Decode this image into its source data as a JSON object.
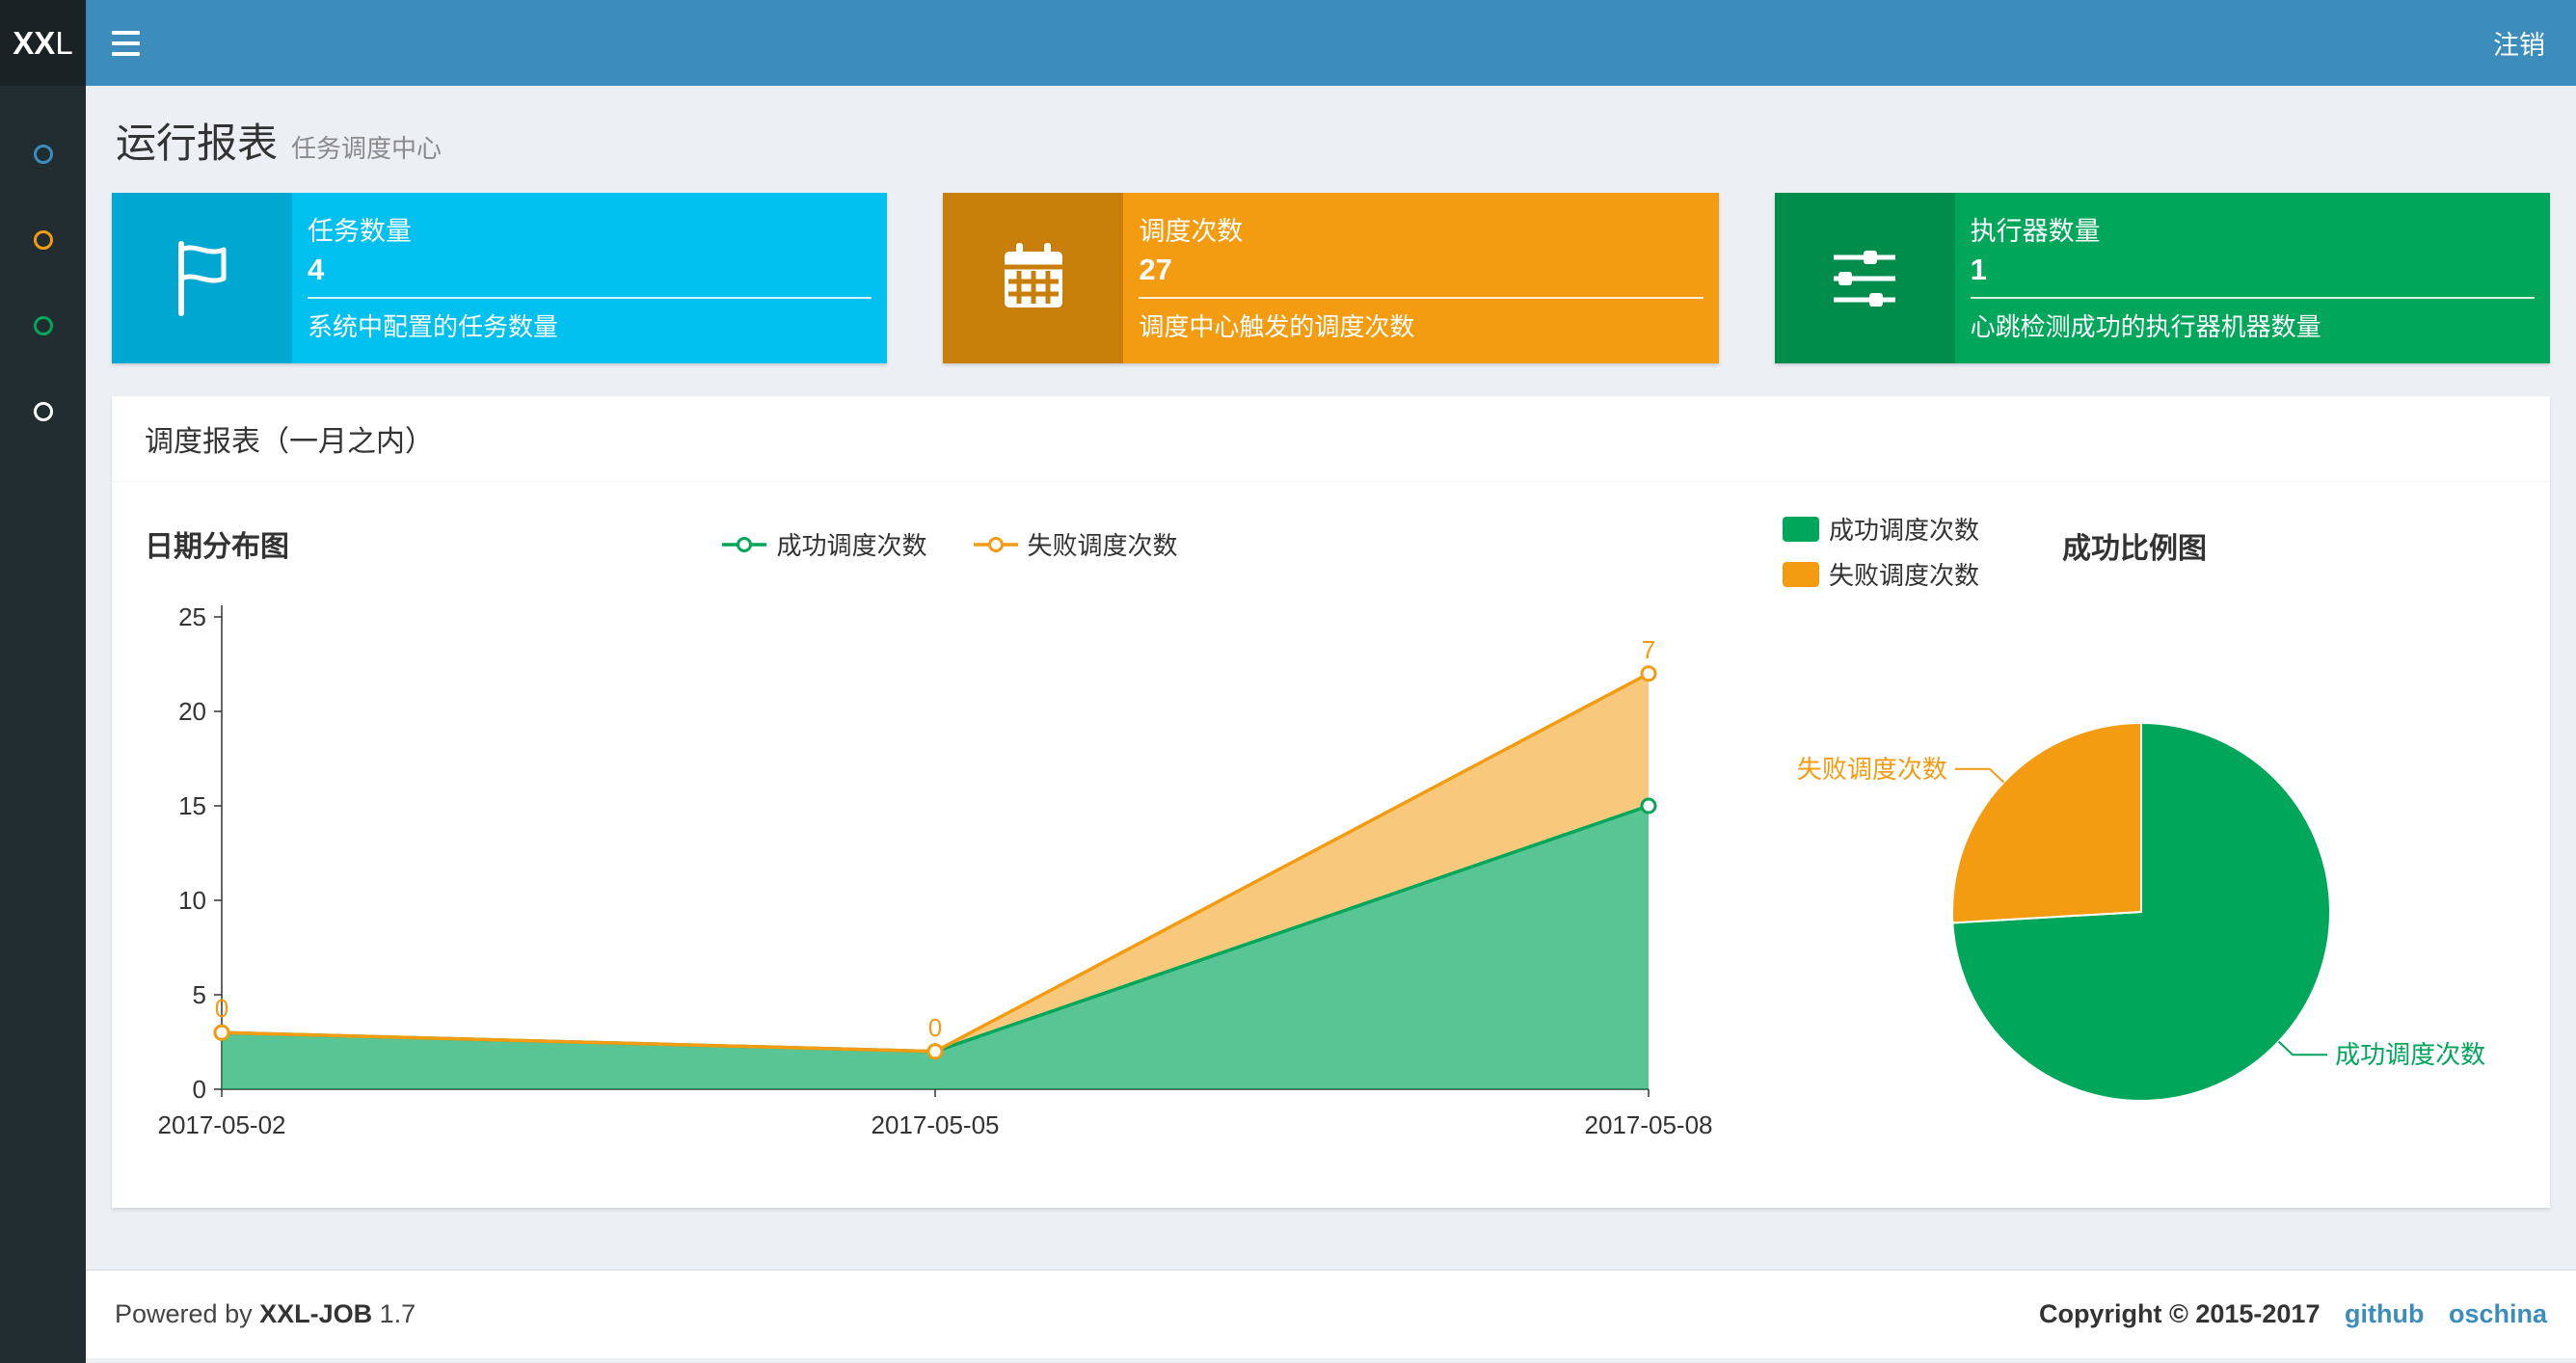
{
  "navbar": {
    "logo_bold": "XX",
    "logo_rest": "L",
    "logout_label": "注销"
  },
  "sidebar": {
    "items": [
      {
        "id": "1",
        "color": "#3c8dbc"
      },
      {
        "id": "2",
        "color": "#f39c12"
      },
      {
        "id": "3",
        "color": "#00a65a"
      },
      {
        "id": "4",
        "color": "#ffffff"
      }
    ]
  },
  "page_header": {
    "title": "运行报表",
    "subtitle": "任务调度中心"
  },
  "info_boxes": [
    {
      "title": "任务数量",
      "number": "4",
      "desc": "系统中配置的任务数量",
      "bg": "#00c0ef",
      "icon_bg": "#00a7d0",
      "icon": "flag-icon"
    },
    {
      "title": "调度次数",
      "number": "27",
      "desc": "调度中心触发的调度次数",
      "bg": "#f39c12",
      "icon_bg": "#c87f0a",
      "icon": "calendar-icon"
    },
    {
      "title": "执行器数量",
      "number": "1",
      "desc": "心跳检测成功的执行器机器数量",
      "bg": "#00a65a",
      "icon_bg": "#008d4c",
      "icon": "sliders-icon"
    }
  ],
  "panel": {
    "title": "调度报表（一月之内）"
  },
  "chart_data": [
    {
      "type": "area",
      "title": "日期分布图",
      "x": [
        "2017-05-02",
        "2017-05-05",
        "2017-05-08"
      ],
      "stacked": true,
      "grid": false,
      "legend_position": "top-center",
      "ylim": [
        0,
        25
      ],
      "yticks": [
        0,
        5,
        10,
        15,
        20,
        25
      ],
      "series": [
        {
          "name": "成功调度次数",
          "color": "#00a65a",
          "fill_opacity": 0.65,
          "values": [
            3,
            2,
            15
          ]
        },
        {
          "name": "失败调度次数",
          "color": "#f39c12",
          "fill_opacity": 0.55,
          "values": [
            0,
            0,
            7
          ],
          "point_labels": [
            "0",
            "0",
            "7"
          ]
        }
      ]
    },
    {
      "type": "pie",
      "title": "成功比例图",
      "legend_position": "top-left",
      "slices": [
        {
          "name": "成功调度次数",
          "value": 20,
          "color": "#00a65a"
        },
        {
          "name": "失败调度次数",
          "value": 7,
          "color": "#f39c12"
        }
      ]
    }
  ],
  "footer": {
    "powered_by": "Powered by",
    "app_name": "XXL-JOB",
    "version": "1.7",
    "copyright": "Copyright © 2015-2017",
    "links": [
      {
        "label": "github"
      },
      {
        "label": "oschina"
      }
    ]
  }
}
